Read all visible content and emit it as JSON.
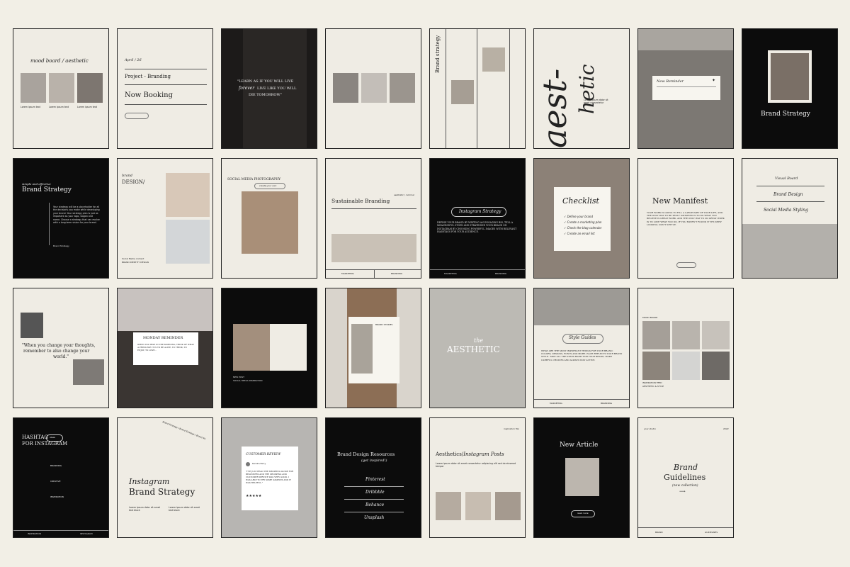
{
  "colors": {
    "background": "#f2efe6",
    "light_tile": "#efece4",
    "dark_tile": "#0c0c0c",
    "photo": "#8a8580"
  },
  "tiles": {
    "r1c1": {
      "title_a": "mood board",
      "title_b": "aesthetic"
    },
    "r1c2": {
      "date": "April / 26",
      "label": "Project - Branding",
      "headline": "Now Booking"
    },
    "r1c3": {
      "quote_a": "\"LEARN AS IF YOU WILL LIVE",
      "quote_b": "forever",
      "quote_c": "LIVE LIKE YOU WILL",
      "quote_d": "DIE TOMORROW\""
    },
    "r1c5": {
      "vertical_title": "Brand strategy"
    },
    "r1c6": {
      "big_a": "aest-",
      "big_b": "hetic"
    },
    "r1c7": {
      "label": "New Reminder"
    },
    "r1c8": {
      "title": "Brand Strategy"
    },
    "r2c1": {
      "kicker": "simple and effective",
      "title": "Brand Strategy",
      "body": "Your strategy will be a placeholder for all the decisions you make while developing your brand. Your strategy plan is just as important as your logo, slogan and name. Choose a strategy that can evolve with a long-term vision for your brand.",
      "sign": "Brand Strategy"
    },
    "r2c2": {
      "kicker": "brand",
      "title": "DESIGN/",
      "footer_a": "Social Media content",
      "footer_b": "BRAND IDENTITY DESIGN"
    },
    "r2c3": {
      "title": "SOCIAL MEDIA PHOTOGRAPHY",
      "pill": "create your own"
    },
    "r2c4": {
      "kicker": "aesthetic / minimal",
      "title": "Sustainable Branding",
      "tab_a": "MARKETING",
      "tab_b": "BRANDING"
    },
    "r2c5": {
      "pill": "Instagram Strategy",
      "body": "DEFINE YOUR BRAND BY WRITING AN ENGAGING BIO, TELL A MEANINGFUL STORY AND STRATEGIZE YOUR BRAND ON INSTAGRAM BY CHOOSING POWERFUL IMAGES WITH RELEVANT HASHTAGS FOR YOUR AUDIENCE.",
      "tab_a": "MARKETING",
      "tab_b": "BRANDING"
    },
    "r2c6": {
      "title": "Checklist",
      "items": [
        "Define your brand",
        "Create a marketing plan",
        "Check the blog calendar",
        "Create an email list"
      ]
    },
    "r2c7": {
      "title": "New Manifest",
      "body": "YOUR WORK IS GOING TO FILL A LARGE PART OF YOUR LIFE, AND THE ONLY WAY TO BE TRULY SATISFIED IS TO DO WHAT YOU BELIEVE IS GREAT WORK. AND THE ONLY WAY TO DO GREAT WORK IS TO LOVE WHAT YOU DO. IF YOU HAVEN'T FOUND IT YET, KEEP LOOKING. DON'T SETTLE."
    },
    "r2c8": {
      "line_a": "Visual Board",
      "line_b": "Brand Design",
      "line_c": "Social Media Styling"
    },
    "r3c1": {
      "quote_a": "\"When you change your thoughts,",
      "quote_b": "remember to also change your",
      "quote_c": "world.\""
    },
    "r3c2": {
      "title": "MONDAY REMINDER",
      "body": "WHEN YOU RISE IN THE MORNING, THINK OF WHAT A PRIVILEGE IT IS TO BE ALIVE, TO THINK, TO ENJOY, TO LOVE..."
    },
    "r3c3": {
      "footer_a": "NEW POST",
      "footer_b": "SOCIAL MEDIA INSPIRATION"
    },
    "r3c4": {
      "label": "BRAND STORIES"
    },
    "r3c5": {
      "kicker": "the",
      "title": "AESTHETIC"
    },
    "r3c6": {
      "pill": "Style Guides",
      "body": "WHAT ARE THE MOST IMPORTANT THINGS FOR YOUR BRAND: COLORS, DESIGNS, FONTS AND MORE. EACH REFLECTS YOUR BRAND STYLE. TAKE ALL THE STEPS RIGHT FOR YOUR BRAND, MAKE CAREFUL CHOICES AND ALWAYS STAY ACTIVE.",
      "tab_a": "MARKETING",
      "tab_b": "BRANDING"
    },
    "r3c7": {
      "label": "MOOD BOARD",
      "footer_a": "INSPIRATION FEED",
      "footer_b": "AESTHETIC & STYLE"
    },
    "r4c1": {
      "title_a": "HASHTAG",
      "title_pill": "ideas",
      "title_b": "FOR INSTAGRAM",
      "sec_a": "BRANDING",
      "sec_b": "CREATIVE",
      "sec_c": "INSPIRATION",
      "tab_a": "INSPIRATION",
      "tab_b": "INSTAGRAM"
    },
    "r4c2": {
      "title_a": "Instagram",
      "title_b": "Brand Strategy",
      "curve": "Brand Strategy / Brand Strategy / Brand Str"
    },
    "r4c3": {
      "title": "CUSTOMER REVIEW",
      "name": "Kendra Perry",
      "stars": "★★★★★",
      "body": "\"I'VE JUST READ THE SHOPPING GUIDE FOR BEGINNERS AND THE SHOPPING AND CUSTOMER SERVICE WAS VERY GOOD. I WAS ABLE TO TRY SOME SAMPLES AND IT WAS HELPFUL.\""
    },
    "r4c4": {
      "title": "Brand Design Resources",
      "sub": "(get inspired!)",
      "items": [
        "Pinterest",
        "Dribbble",
        "Behance",
        "Unsplash"
      ]
    },
    "r4c5": {
      "kicker": "inspiration file",
      "title_a": "Aesthetics",
      "title_b": "Instagram Posts"
    },
    "r4c6": {
      "title": "New Article",
      "pill": "read more"
    },
    "r4c7": {
      "kicker": "your studio",
      "year": "2022",
      "title_a": "Brand",
      "title_b": "Guidelines",
      "sub": "(new collection)",
      "tab_a": "BRAND",
      "tab_b": "GUIDELINES"
    }
  }
}
